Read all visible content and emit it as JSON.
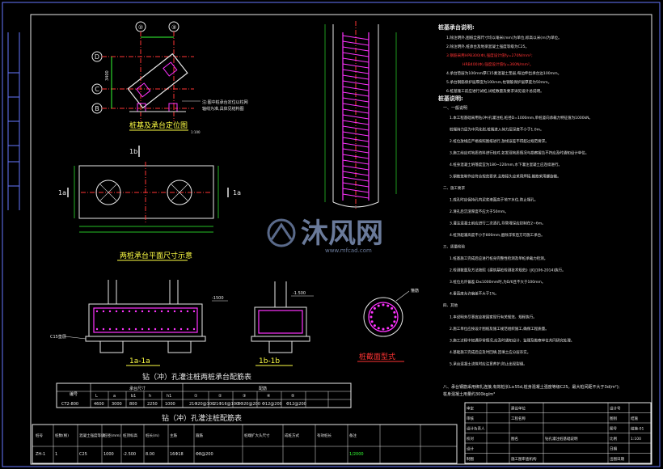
{
  "watermark": {
    "brand": "沐风网",
    "url": "www.mfcad.com"
  },
  "axis_labels": {
    "top_left": "②",
    "top_right": "③",
    "left_top": "D",
    "left_mid": "C",
    "left_bottom": "B",
    "dims": [
      "3400",
      "3160"
    ]
  },
  "cap_plan": {
    "title": "桩基及承台定位图",
    "scale": "1:100",
    "note_line1": "注:图中桩承台定位以柱网",
    "note_line2": "轴线为准,具体见结构图"
  },
  "plan_view": {
    "title": "两桩承台平面尺寸示意",
    "section_top": "1b",
    "section_left": "1a",
    "section_right": "1a",
    "section_bottom": "1b"
  },
  "section_views": {
    "sec1_title": "1a-1a",
    "sec2_title": "1b-1b",
    "sec1_tag": "C15垫层",
    "sec1_dim": "-1500",
    "sec2_dim": "-1.500",
    "ring_label": "箍筋"
  },
  "pile_section": {
    "title": "桩截面型式"
  },
  "table1": {
    "title": "钻（冲）孔灌注桩两桩承台配筋表",
    "headers": [
      "编号",
      "承台尺寸",
      "配筋"
    ],
    "subheaders": [
      "L",
      "a",
      "b1",
      "h",
      "h1",
      "①",
      "②",
      "③",
      "④",
      "⑤"
    ],
    "rows": [
      [
        "CT2-800",
        "4600",
        "3000",
        "800",
        "2250",
        "1000",
        "21Φ20@100",
        "21Φ16@100",
        "8Φ20@200",
        "Φ12@200",
        "Φ12@200"
      ]
    ]
  },
  "table2": {
    "title": "钻（冲）孔灌注桩配筋表",
    "headers": [
      "桩号",
      "桩数(根)",
      "混凝土强度等级",
      "桩径(mm)",
      "桩顶标高",
      "桩长(m)",
      "主筋",
      "箍筋",
      "桩端扩大头尺寸",
      "成桩方式",
      "有效桩长",
      "备注"
    ],
    "row": [
      "ZH-1",
      "1",
      "C25",
      "1000",
      "-2.500",
      "8.00",
      "16Φ18",
      "Φ8@200",
      "",
      "",
      "",
      "1/2000"
    ]
  },
  "notes_section1": {
    "title": "桩基承台说明:",
    "items": [
      "1.除注明外,图纸全部尺寸均以毫米(mm)为单位,标高以米(m)为单位。",
      "2.除注明外,桩承台及地梁混凝土强度等级为C25。",
      "3.钢筋采用HPB300(Φ),强度设计值fy=270N/mm²;",
      "HRB400(Φ),强度设计值fy=360N/mm²。",
      "4.承台垫层为100mm厚C15素混凝土垫层,每边伸出承台边100mm。",
      "5.承台钢筋保护层厚度为100mm,柱钢筋保护层厚度为50mm。",
      "6.桩基施工前应进行试桩,试桩数量及要求详见设计总说明。"
    ]
  },
  "notes_section2": {
    "title": "桩基说明:",
    "heading1": "一、一般说明",
    "paras": [
      "1.本工程基础采用钻(冲)孔灌注桩,桩径D=1000mm,单桩竖向承载力特征值为1000kN。",
      "桩端持力层为中风化岩,桩端进入持力层深度不小于1.0m。",
      "2.桩位放线应严格按照图纸进行,放线误差不得超过规范要求。",
      "3.施工前应对地质资料进行核对,如发现地质情况与勘察报告不符应及时通知设计单位。",
      "4.桩身混凝土坍落度宜为180~220mm,水下灌注混凝土应连续进行。",
      "5.钢筋笼制作应符合规范要求,主筋接头应采用焊接,箍筋采用螺旋箍。",
      "二、施工要求",
      "1.成孔时应保持孔内泥浆液面高于地下水位,防止塌孔。",
      "2.清孔后沉渣厚度不应大于50mm。",
      "3.灌注混凝土前应进行二次清孔,导管埋深应控制在2~6m。",
      "4.桩顶超灌高度不小于800mm,凿除浮浆后方可施工承台。",
      "三、质量检验",
      "1.桩基施工完成后应进行桩身完整性检测及单桩承载力检测。",
      "2.检测数量及方法按照《建筑基桩检测技术规范》(JGJ106-2014)执行。",
      "3.桩位允许偏差:D≤1000mm时,为D/6且不大于100mm。",
      "4.垂直度允许偏差不大于1%。",
      "四、其他",
      "1.本说明未尽事宜应按国家现行有关规范、规程执行。",
      "2.施工单位应按设计图纸及施工规范组织施工,确保工程质量。",
      "3.施工过程中如遇异常情况,应及时通知设计、监理及勘察单位共同研究处理。",
      "4.基础施工完成后应及时回填,回填土应分层夯实。",
      "5.承台混凝土浇筑时应注意养护,防止出现裂缝。"
    ],
    "footer": "八、承台钢筋采用绑扎连接,有效桩长L≥55d,桩身混凝土强度等级C25。最大桩间距不大于3d(m²);",
    "footer2": "桩身混凝土用量约300kg/m³"
  },
  "title_block": {
    "rows": [
      [
        "审定",
        "",
        "建设单位",
        "",
        "设计号",
        ""
      ],
      [
        "审核",
        "",
        "工程名称",
        "",
        "图别",
        "结施"
      ],
      [
        "设计负责人",
        "",
        "",
        "",
        "图号",
        "结施-01"
      ],
      [
        "校对",
        "",
        "图名",
        "钻孔灌注桩基础说明",
        "比例",
        "1:100"
      ],
      [
        "设计",
        "",
        "",
        "",
        "日期",
        ""
      ],
      [
        "制图",
        "",
        "施工图审查机构",
        "",
        "出图日期",
        ""
      ]
    ]
  },
  "colors": {
    "background": "#000000",
    "line_white": "#e8e8e8",
    "magenta": "#ff33ff",
    "yellow": "#ffff44",
    "cyan": "#33ffff",
    "red": "#ff3333",
    "green": "#33cc33",
    "blue": "#6677ff"
  }
}
